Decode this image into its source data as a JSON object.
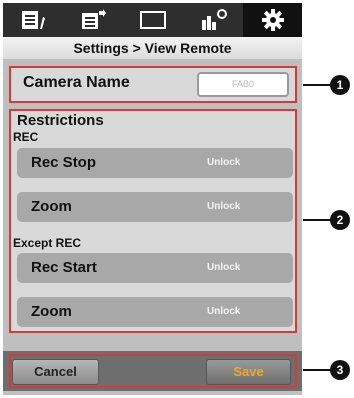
{
  "breadcrumb": "Settings > View Remote",
  "tabs": [
    {
      "icon": "list-edit-icon"
    },
    {
      "icon": "clip-list-icon"
    },
    {
      "icon": "viewfinder-icon"
    },
    {
      "icon": "camera-settings-icon"
    },
    {
      "icon": "gear-icon",
      "active": true
    }
  ],
  "camera": {
    "label": "Camera Name",
    "value": "FAB0"
  },
  "restrictions": {
    "title": "Restrictions",
    "groups": [
      {
        "label": "REC",
        "items": [
          {
            "name": "Rec Stop",
            "state": "Unlock"
          },
          {
            "name": "Zoom",
            "state": "Unlock"
          }
        ]
      },
      {
        "label": "Except REC",
        "items": [
          {
            "name": "Rec Start",
            "state": "Unlock"
          },
          {
            "name": "Zoom",
            "state": "Unlock"
          }
        ]
      }
    ]
  },
  "footer": {
    "cancel_label": "Cancel",
    "save_label": "Save"
  },
  "callouts": [
    "1",
    "2",
    "3"
  ],
  "colors": {
    "highlight": "#d43a3a",
    "save_text": "#f0a828"
  }
}
